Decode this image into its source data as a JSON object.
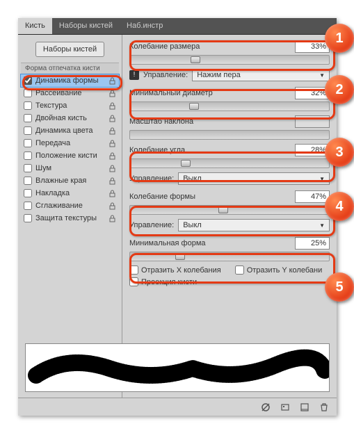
{
  "tabs": {
    "brush": "Кисть",
    "presets": "Наборы кистей",
    "tools": "Наб.инстр"
  },
  "sidebar": {
    "presets_btn": "Наборы кистей",
    "shape_header": "Форма отпечатка кисти",
    "items": [
      {
        "label": "Динамика формы",
        "checked": true,
        "sel": true
      },
      {
        "label": "Рассеивание",
        "checked": false
      },
      {
        "label": "Текстура",
        "checked": false
      },
      {
        "label": "Двойная кисть",
        "checked": false
      },
      {
        "label": "Динамика цвета",
        "checked": false
      },
      {
        "label": "Передача",
        "checked": false
      },
      {
        "label": "Положение кисти",
        "checked": false
      },
      {
        "label": "Шум",
        "checked": false
      },
      {
        "label": "Влажные края",
        "checked": false
      },
      {
        "label": "Накладка",
        "checked": false
      },
      {
        "label": "Сглаживание",
        "checked": false
      },
      {
        "label": "Защита текстуры",
        "checked": false
      }
    ]
  },
  "controls": {
    "size_jitter": {
      "label": "Колебание размера",
      "value": "33%",
      "pos": 33
    },
    "ctrl1": {
      "label": "Управление:",
      "value": "Нажим пера"
    },
    "min_diam": {
      "label": "Минимальный диаметр",
      "value": "32%",
      "pos": 32
    },
    "tilt": {
      "label": "Масштаб наклона",
      "value": ""
    },
    "angle_jitter": {
      "label": "Колебание угла",
      "value": "28%",
      "pos": 28
    },
    "ctrl2": {
      "label": "Управление:",
      "value": "Выкл"
    },
    "round_jitter": {
      "label": "Колебание формы",
      "value": "47%",
      "pos": 47
    },
    "ctrl3": {
      "label": "Управление:",
      "value": "Выкл"
    },
    "min_round": {
      "label": "Минимальная форма",
      "value": "25%",
      "pos": 25
    },
    "flip_x": "Отразить X колебания",
    "flip_y": "Отразить Y колебани",
    "proj": "Проекция кисти"
  },
  "callouts": [
    "1",
    "2",
    "3",
    "4",
    "5"
  ]
}
